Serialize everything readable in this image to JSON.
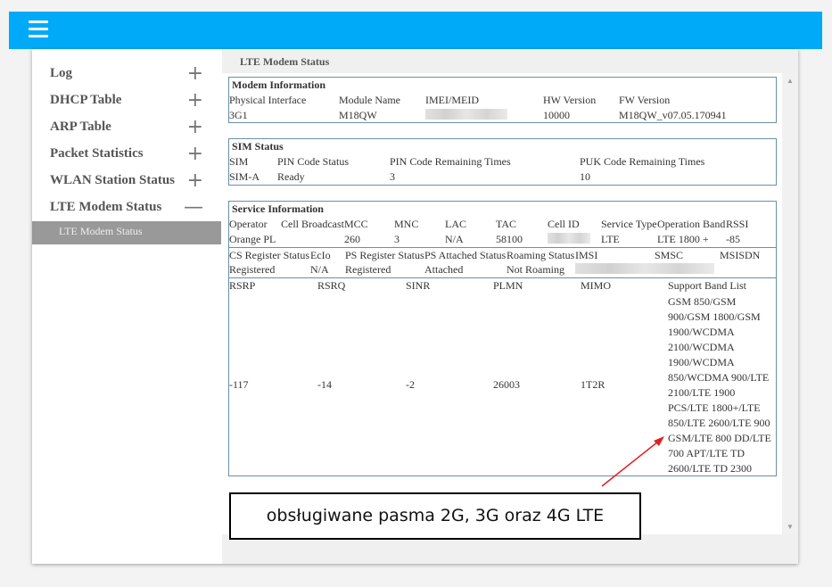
{
  "header": {
    "menu_icon": "hamburger-icon",
    "color": "#00aaf8"
  },
  "sidebar": {
    "items": [
      {
        "label": "Log",
        "icon": "+"
      },
      {
        "label": "DHCP Table",
        "icon": "+"
      },
      {
        "label": "ARP Table",
        "icon": "+"
      },
      {
        "label": "Packet Statistics",
        "icon": "+"
      },
      {
        "label": "WLAN Station Status",
        "icon": "+"
      },
      {
        "label": "LTE Modem Status",
        "icon": "—"
      }
    ],
    "sub_item": "LTE Modem Status"
  },
  "content": {
    "title": "LTE Modem Status"
  },
  "modem": {
    "title": "Modem Information",
    "headers": [
      "Physical Interface",
      "Module Name",
      "IMEI/MEID",
      "HW Version",
      "FW Version"
    ],
    "values": [
      "3G1",
      "M18QW",
      "",
      "10000",
      "M18QW_v07.05.170941"
    ]
  },
  "sim": {
    "title": "SIM Status",
    "headers": [
      "SIM",
      "PIN Code Status",
      "PIN Code Remaining Times",
      "PUK Code Remaining Times"
    ],
    "values": [
      "SIM-A",
      "Ready",
      "3",
      "10"
    ]
  },
  "service": {
    "title": "Service Information",
    "row1_headers": [
      "Operator",
      "Cell Broadcast",
      "MCC",
      "MNC",
      "LAC",
      "TAC",
      "Cell ID",
      "Service Type",
      "Operation Band",
      "RSSI"
    ],
    "row1_values": [
      "Orange PL",
      "",
      "260",
      "3",
      "N/A",
      "58100",
      "",
      "LTE",
      "LTE 1800 +",
      "-85"
    ],
    "row2_headers": [
      "CS Register Status",
      "EcIo",
      "PS Register Status",
      "PS Attached Status",
      "Roaming Status",
      "IMSI",
      "SMSC",
      "MSISDN"
    ],
    "row2_values": [
      "Registered",
      "N/A",
      "Registered",
      "Attached",
      "Not Roaming",
      ""
    ],
    "row3_headers": [
      "RSRP",
      "RSRQ",
      "SINR",
      "PLMN",
      "MIMO",
      "Support Band List"
    ],
    "row3_values": [
      "-117",
      "-14",
      "-2",
      "26003",
      "1T2R"
    ],
    "band_list": [
      "GSM 850/GSM",
      "900/GSM 1800/GSM",
      "1900/WCDMA",
      "2100/WCDMA",
      "1900/WCDMA",
      "850/WCDMA 900/LTE",
      "2100/LTE 1900",
      "PCS/LTE 1800+/LTE",
      "850/LTE 2600/LTE 900",
      "GSM/LTE 800 DD/LTE",
      "700 APT/LTE TD",
      "2600/LTE TD 2300"
    ]
  },
  "annotation": {
    "text": "obsługiwane pasma 2G, 3G oraz 4G LTE",
    "arrow_color": "#e02020"
  }
}
